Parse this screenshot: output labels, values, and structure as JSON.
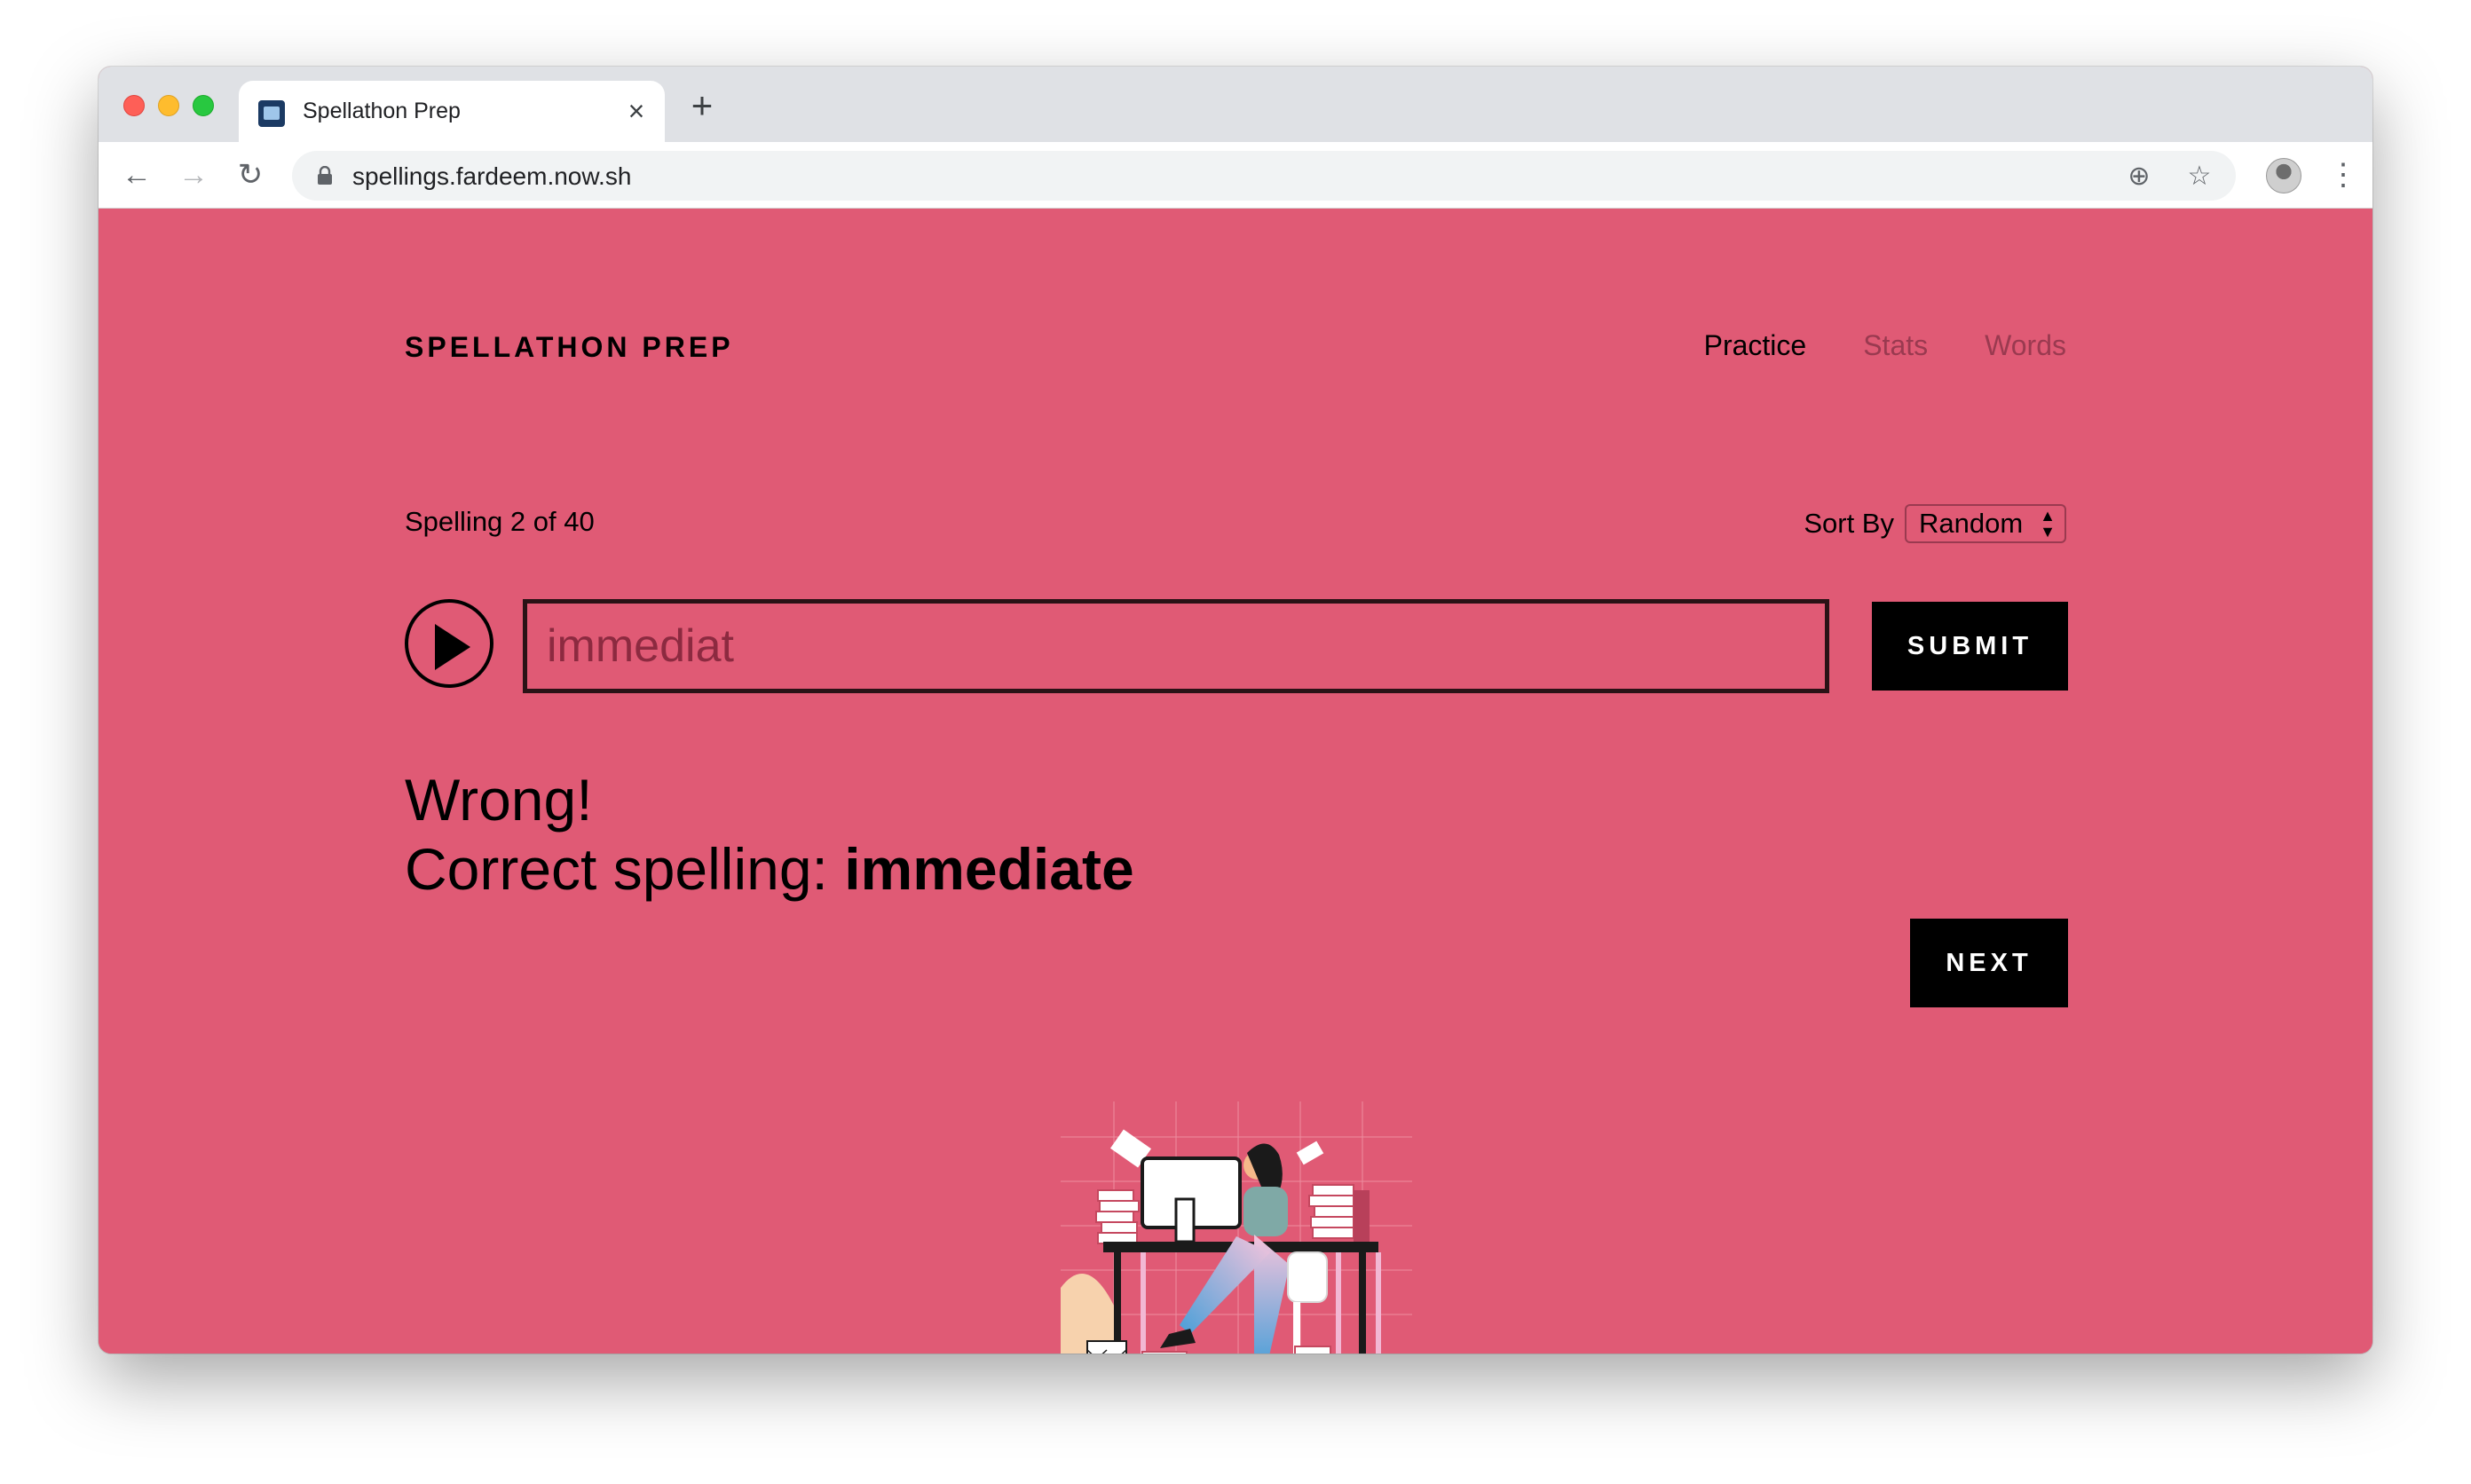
{
  "browser": {
    "tab_title": "Spellathon Prep",
    "url": "spellings.fardeem.now.sh"
  },
  "header": {
    "brand": "SPELLATHON PREP",
    "nav": [
      {
        "label": "Practice",
        "active": true
      },
      {
        "label": "Stats",
        "active": false
      },
      {
        "label": "Words",
        "active": false
      }
    ]
  },
  "quiz": {
    "progress_text": "Spelling 2 of 40",
    "sort_label": "Sort By",
    "sort_value": "Random",
    "input_value": "immediat",
    "submit_label": "SUBMIT",
    "result_heading": "Wrong!",
    "correct_prefix": "Correct spelling: ",
    "correct_word": "immediate",
    "next_label": "NEXT"
  },
  "colors": {
    "page_background": "#e05a75",
    "button_background": "#000000",
    "inactive_nav": "#9a3a50"
  },
  "icons": {
    "play": "play-icon",
    "back": "back-arrow-icon",
    "forward": "forward-arrow-icon",
    "reload": "reload-icon",
    "lock": "lock-icon",
    "add_to_home": "add-circle-icon",
    "bookmark": "star-icon",
    "menu": "kebab-menu-icon"
  }
}
